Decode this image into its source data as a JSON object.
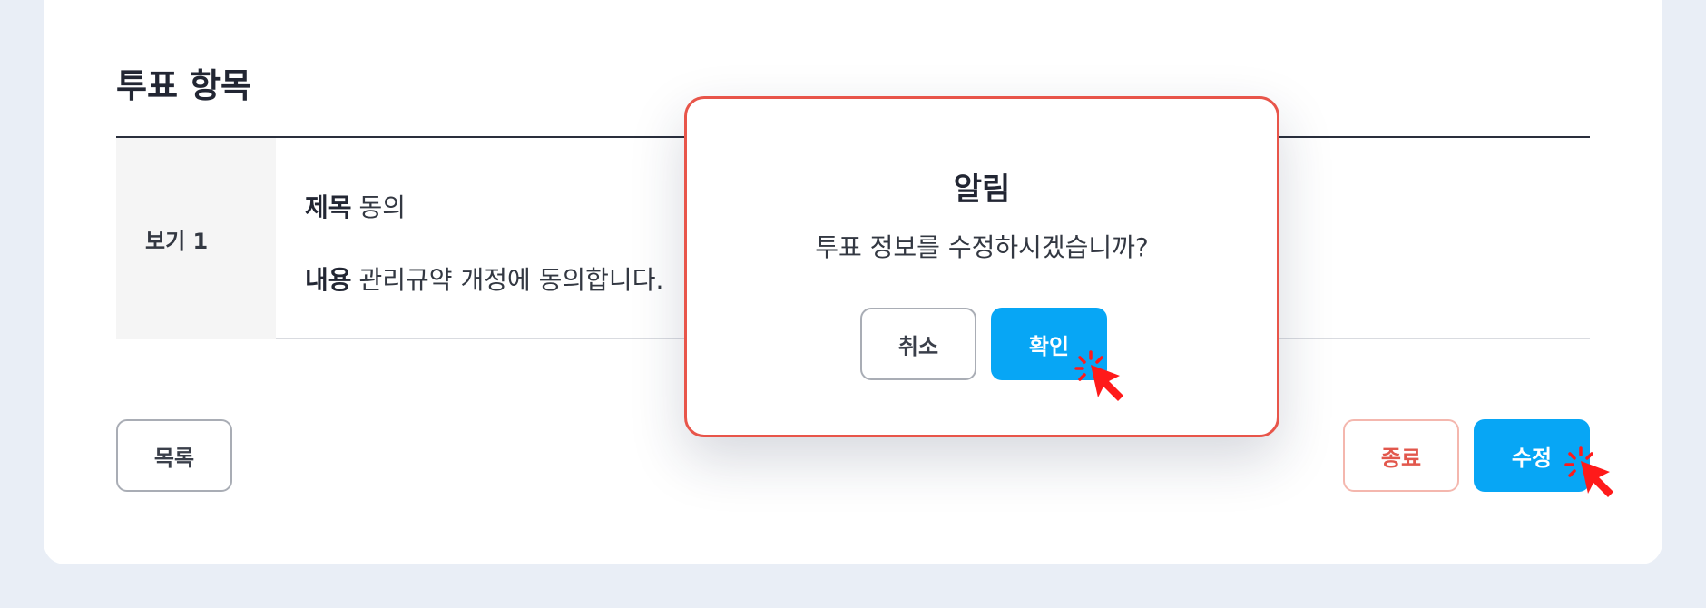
{
  "section": {
    "title": "투표 항목"
  },
  "vote_items": [
    {
      "head": "보기 1",
      "title_label": "제목",
      "title_value": "동의",
      "content_label": "내용",
      "content_value": "관리규약 개정에 동의합니다."
    }
  ],
  "actions": {
    "list_label": "목록",
    "end_label": "종료",
    "edit_label": "수정"
  },
  "modal": {
    "title": "알림",
    "message": "투표 정보를 수정하시겠습니까?",
    "cancel_label": "취소",
    "confirm_label": "확인"
  },
  "colors": {
    "primary": "#07a6f5",
    "danger": "#e2574c",
    "modal_border": "#e8554a",
    "cursor": "#ff1a1a"
  }
}
